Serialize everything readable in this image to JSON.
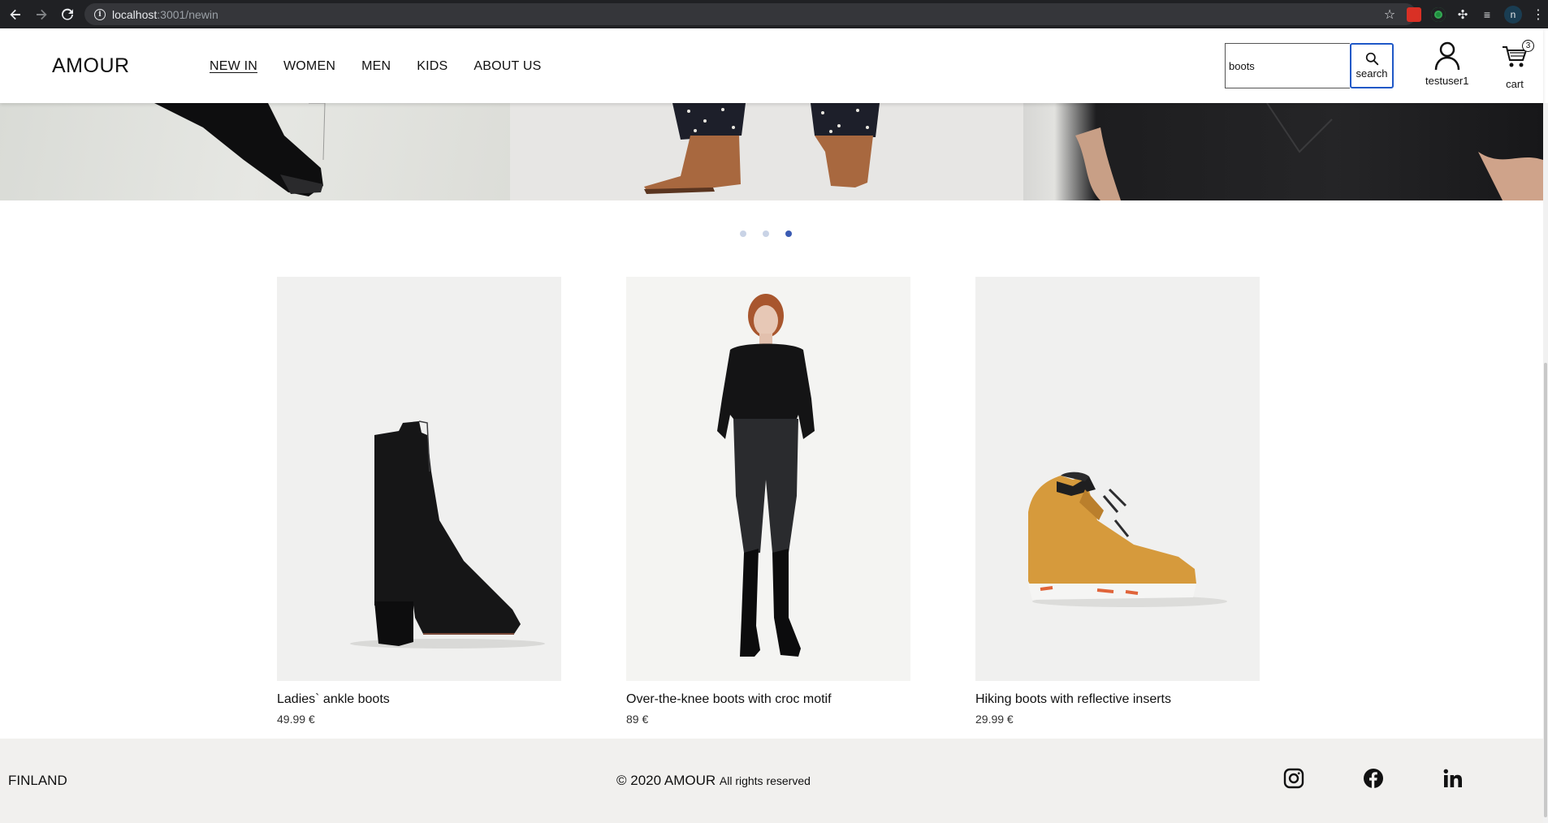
{
  "browser": {
    "url_host": "localhost",
    "url_path": ":3001/newin"
  },
  "header": {
    "logo": "AMOUR",
    "nav": [
      {
        "label": "NEW IN",
        "active": true
      },
      {
        "label": "WOMEN",
        "active": false
      },
      {
        "label": "MEN",
        "active": false
      },
      {
        "label": "KIDS",
        "active": false
      },
      {
        "label": "ABOUT US",
        "active": false
      }
    ],
    "search": {
      "value": "boots",
      "button_label": "search"
    },
    "user": {
      "name": "testuser1"
    },
    "cart": {
      "label": "cart",
      "count": "3"
    }
  },
  "slider": {
    "slide_count": 3,
    "active_index": 2
  },
  "products": [
    {
      "name": "Ladies` ankle boots",
      "price": "49.99 €"
    },
    {
      "name": "Over-the-knee boots with croc motif",
      "price": "89 €"
    },
    {
      "name": "Hiking boots with reflective inserts",
      "price": "29.99 €"
    }
  ],
  "footer": {
    "country": "FINLAND",
    "copyright": "© 2020 AMOUR",
    "rights": "All rights reserved",
    "socials": [
      "instagram-icon",
      "facebook-icon",
      "linkedin-icon"
    ]
  },
  "colors": {
    "accent_blue": "#1f58c7",
    "dot_active": "#3b5bb3",
    "dot_inactive": "#c9d3e6",
    "footer_bg": "#f1f0ee"
  }
}
